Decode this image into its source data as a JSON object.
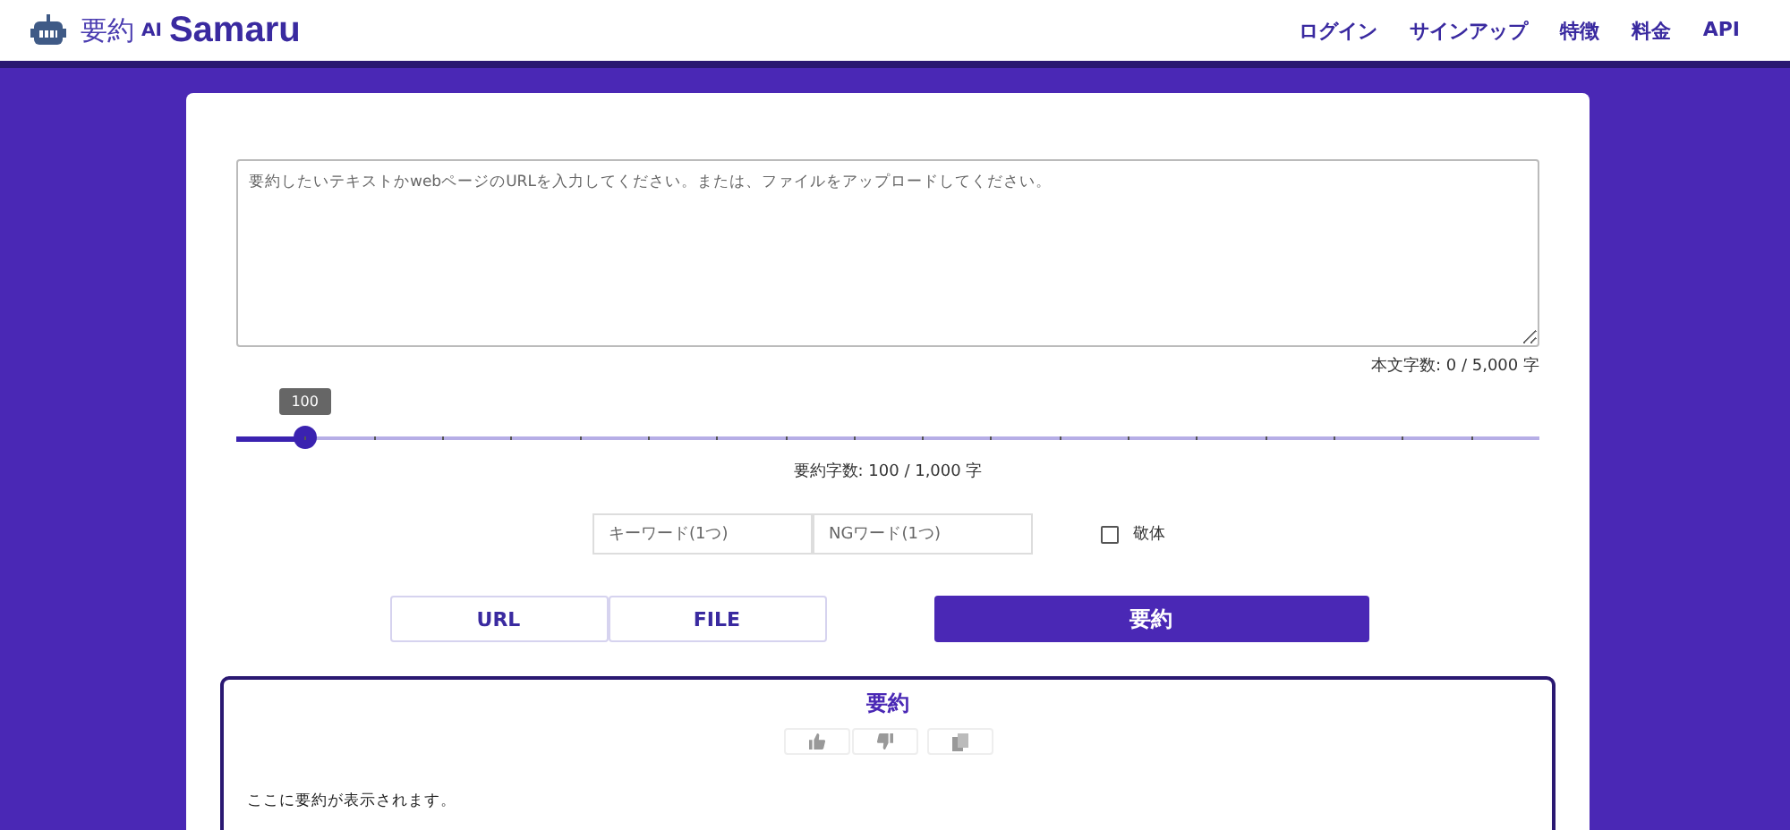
{
  "header": {
    "logo_text": "要約",
    "logo_ai": "AI",
    "logo_brand": "Samaru",
    "nav": [
      "ログイン",
      "サインアップ",
      "特徴",
      "料金",
      "API"
    ]
  },
  "input": {
    "placeholder": "要約したいテキストかwebページのURLを入力してください。または、ファイルをアップロードしてください。",
    "count": "本文字数: 0 / 5,000 字"
  },
  "slider": {
    "tooltip": "100",
    "level": 0.052,
    "reading": "要約字数: 100 / 1,000 字"
  },
  "keyword": {
    "placeholder": "キーワード(1つ)"
  },
  "ng_keyword": {
    "placeholder": "NGワード(1つ)"
  },
  "polite": {
    "label": "敬体",
    "checked": false
  },
  "source_buttons": [
    "URL",
    "FILE"
  ],
  "summarize_button": "要約",
  "result": {
    "title": "要約",
    "text": "ここに要約が表示されます。"
  }
}
